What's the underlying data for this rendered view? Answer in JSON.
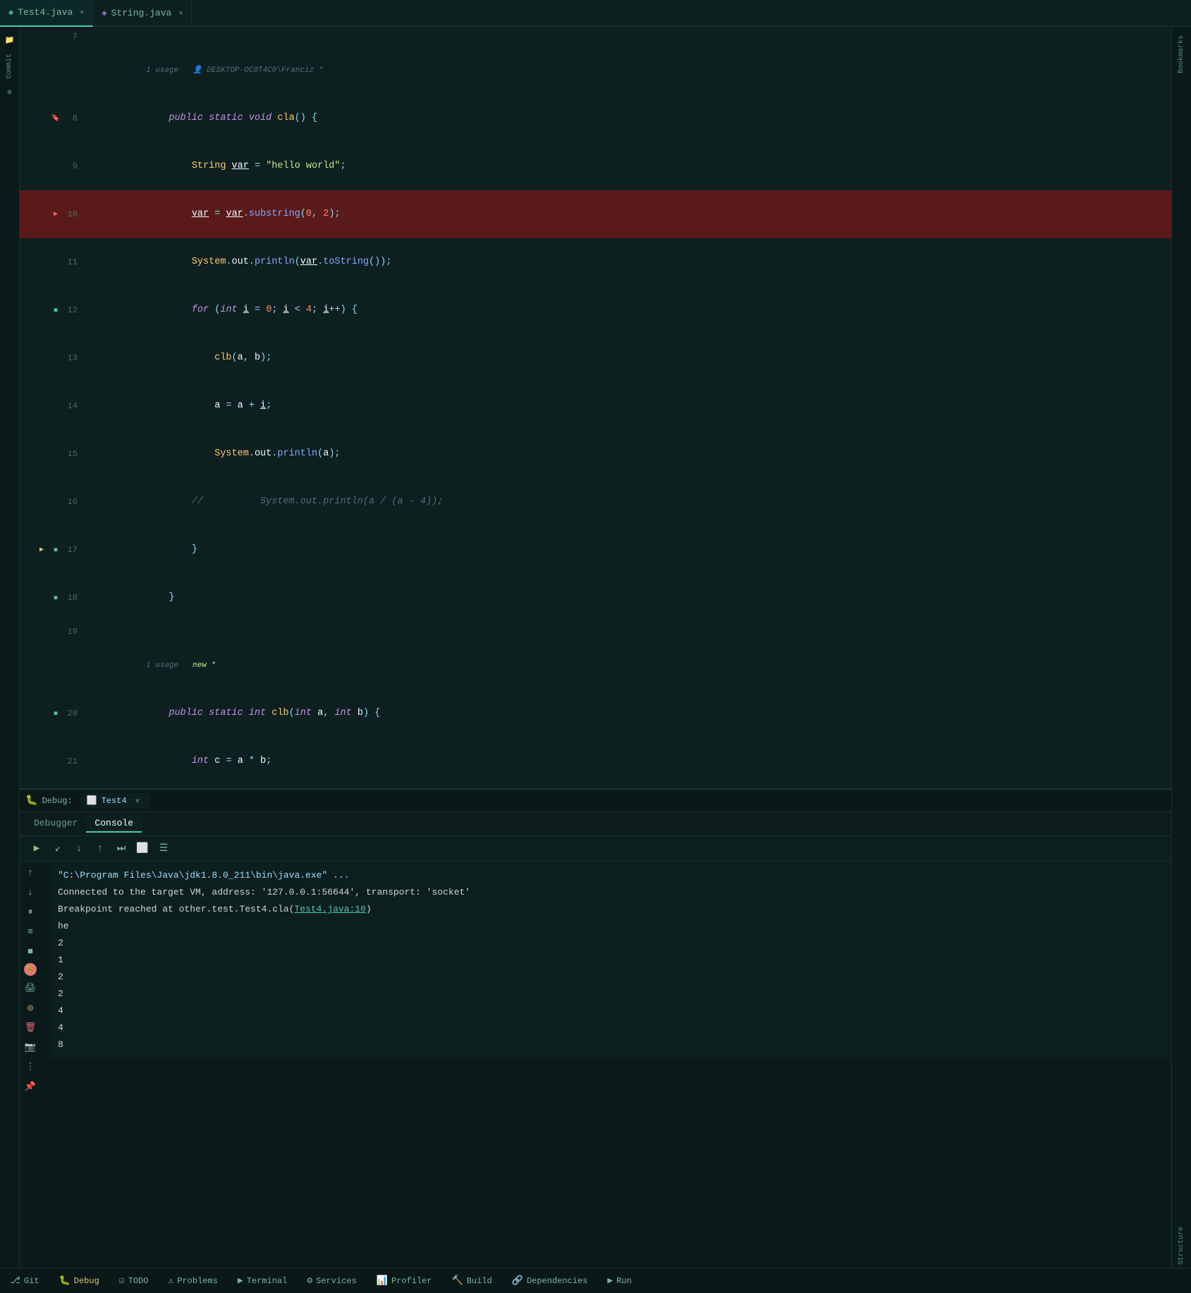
{
  "tabs": [
    {
      "id": "test4",
      "label": "Test4.java",
      "icon": "T",
      "active": true,
      "modified": false
    },
    {
      "id": "string",
      "label": "String.java",
      "icon": "S",
      "active": false,
      "modified": false
    }
  ],
  "editor": {
    "meta1": "1 usage   🧑 DESKTOP-OC0T4C0\\Franciz *",
    "meta2": "1 usage   new *"
  },
  "debug": {
    "label": "Debug:",
    "session": "Test4",
    "tabs": [
      {
        "label": "Debugger",
        "active": false
      },
      {
        "label": "Console",
        "active": true
      }
    ],
    "toolbar_buttons": [
      "▶",
      "↓",
      "↓",
      "↑",
      "⏭",
      "⬜",
      "☰"
    ],
    "console_lines": [
      "\"C:\\Program Files\\Java\\jdk1.8.0_211\\bin\\java.exe\" ...",
      "Connected to the target VM, address: '127.0.0.1:56644', transport: 'socket'",
      "Breakpoint reached at other.test.Test4.cla(Test4.java:10)",
      "he",
      "2",
      "1",
      "2",
      "2",
      "4",
      "4",
      "8"
    ]
  },
  "bottom_bar": {
    "items": [
      {
        "icon": "⎇",
        "label": "Git"
      },
      {
        "icon": "🐛",
        "label": "Debug"
      },
      {
        "icon": "☑",
        "label": "TODO"
      },
      {
        "icon": "⚠",
        "label": "Problems"
      },
      {
        "icon": "▶",
        "label": "Terminal"
      },
      {
        "icon": "⚙",
        "label": "Services"
      },
      {
        "icon": "📊",
        "label": "Profiler"
      },
      {
        "icon": "🔨",
        "label": "Build"
      },
      {
        "icon": "🔗",
        "label": "Dependencies"
      },
      {
        "icon": "▶",
        "label": "Run"
      }
    ]
  }
}
